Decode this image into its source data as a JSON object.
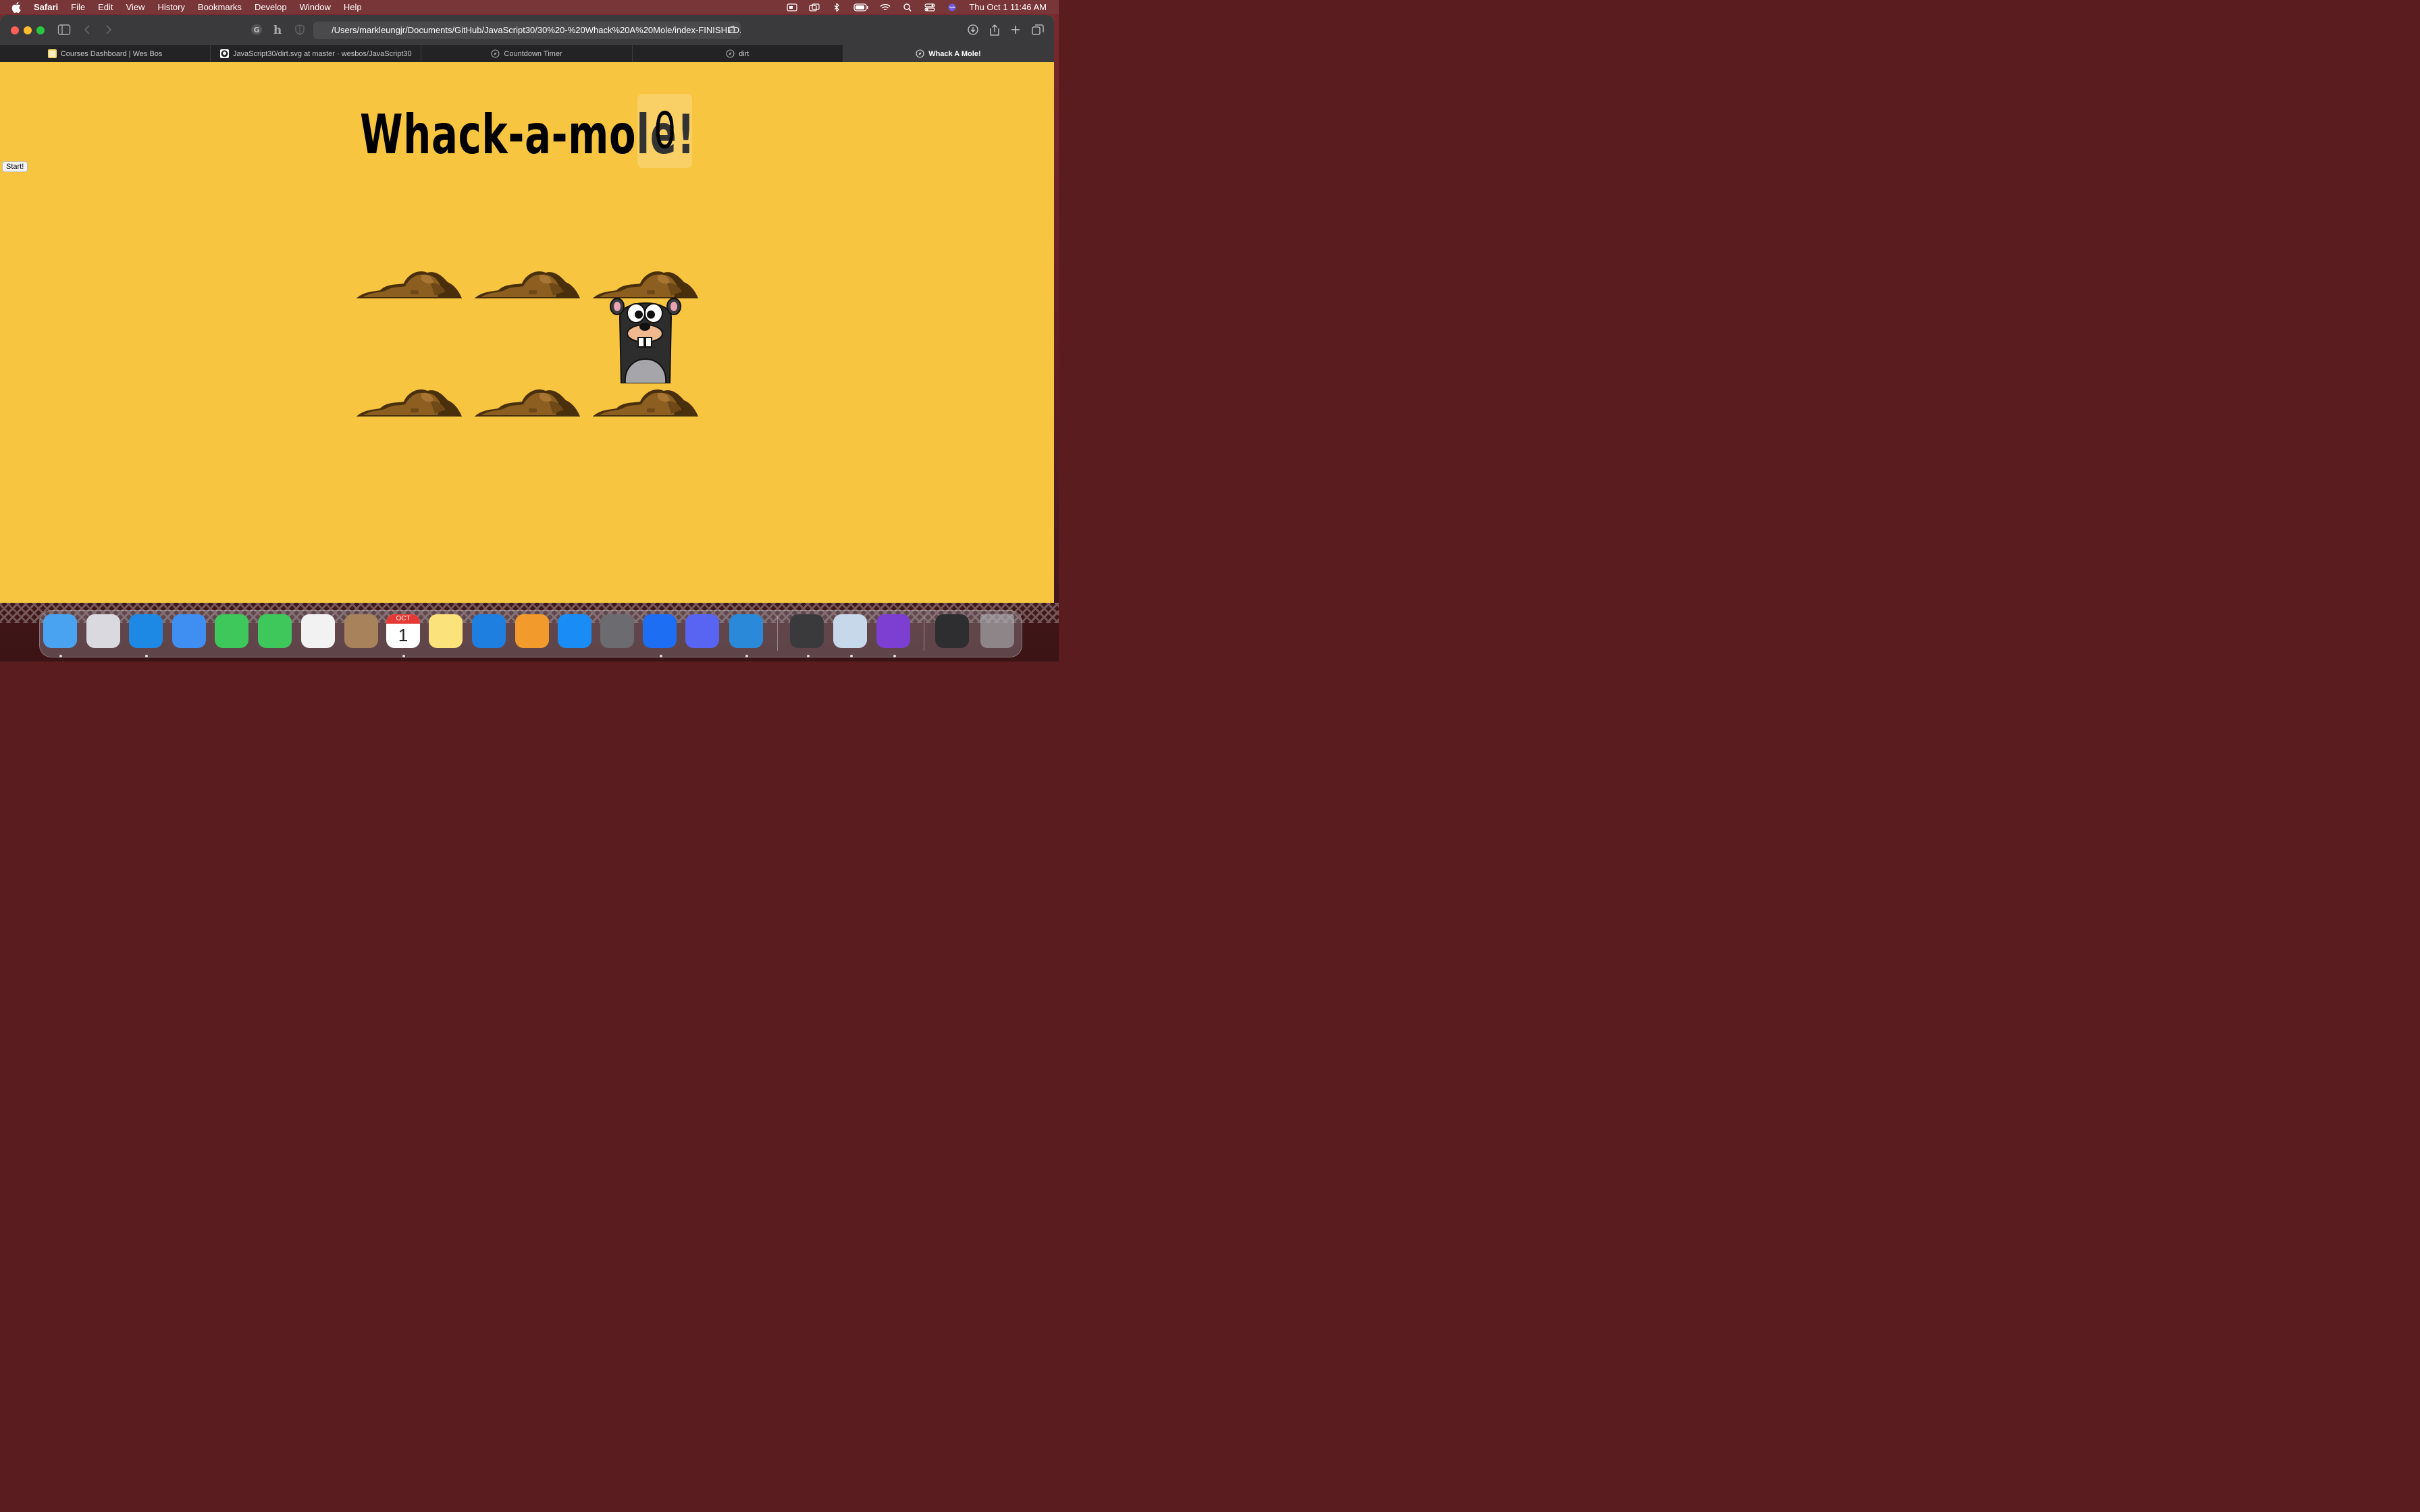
{
  "menubar": {
    "app_name": "Safari",
    "items": [
      "File",
      "Edit",
      "View",
      "History",
      "Bookmarks",
      "Develop",
      "Window",
      "Help"
    ],
    "clock": "Thu Oct 1  11:46 AM"
  },
  "browser": {
    "url": "/Users/markleungjr/Documents/GitHub/JavaScript30/30%20-%20Whack%20A%20Mole/index-FINISHED.html",
    "tabs": [
      {
        "label": "Courses Dashboard | Wes Bos",
        "active": false
      },
      {
        "label": "JavaScript30/dirt.svg at master · wesbos/JavaScript30",
        "active": false
      },
      {
        "label": "Countdown Timer",
        "active": false
      },
      {
        "label": "dirt",
        "active": false
      },
      {
        "label": "Whack A Mole!",
        "active": true
      }
    ]
  },
  "game": {
    "start_label": "Start!",
    "title": "Whack-a-mole!",
    "score": "0",
    "mole_visible_in_hole": 5
  },
  "dock": {
    "calendar_month": "OCT",
    "calendar_day": "1",
    "apps": [
      "Finder",
      "Launchpad",
      "Safari",
      "Mail",
      "FaceTime",
      "Messages",
      "Photos",
      "Contacts",
      "Calendar",
      "Notes",
      "Keynote",
      "Pages",
      "App Store",
      "System Preferences",
      "Messenger",
      "Discord",
      "Visual Studio Code",
      "Calculator",
      "Preview",
      "GitHub Desktop",
      "Downloads",
      "Trash"
    ]
  },
  "colors": {
    "page_background": "#f7c540",
    "dirt_dark": "#4a2f0c",
    "dirt_light": "#8c5f21"
  }
}
